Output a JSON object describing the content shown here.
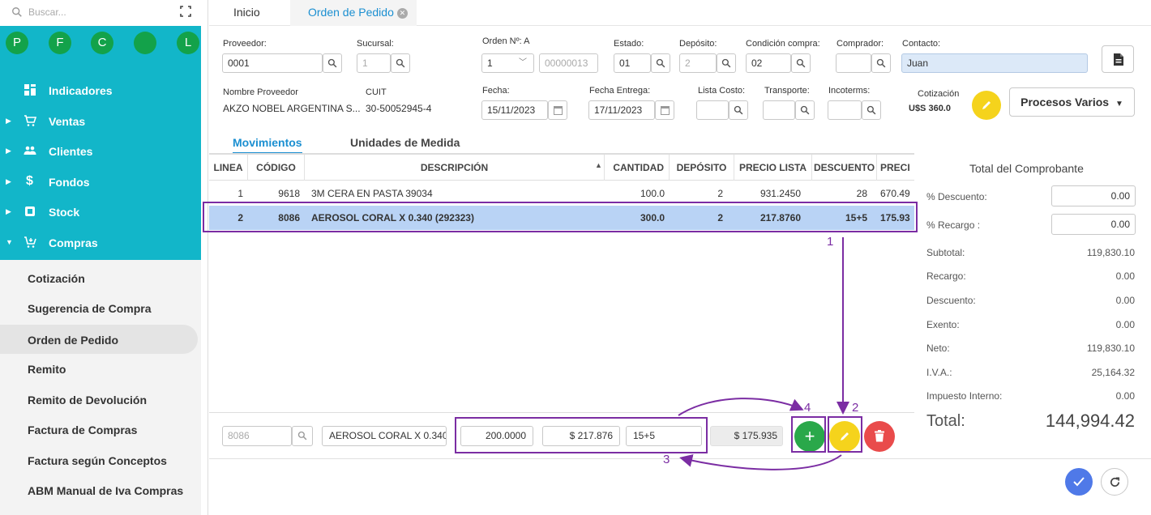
{
  "sidebar": {
    "search_placeholder": "Buscar...",
    "quick_circles": [
      "P",
      "F",
      "C",
      "",
      "L"
    ],
    "menu": [
      {
        "label": "Indicadores",
        "icon": "dashboard-icon",
        "expandable": false
      },
      {
        "label": "Ventas",
        "icon": "cart-icon",
        "expandable": true
      },
      {
        "label": "Clientes",
        "icon": "people-icon",
        "expandable": true
      },
      {
        "label": "Fondos",
        "icon": "dollar-icon",
        "expandable": true
      },
      {
        "label": "Stock",
        "icon": "box-icon",
        "expandable": true
      },
      {
        "label": "Compras",
        "icon": "cart-down-icon",
        "expandable": true,
        "expanded": true
      }
    ],
    "submenu": [
      {
        "label": "Cotización"
      },
      {
        "label": "Sugerencia de Compra"
      },
      {
        "label": "Orden de Pedido",
        "active": true
      },
      {
        "label": "Remito"
      },
      {
        "label": "Remito de Devolución"
      },
      {
        "label": "Factura de Compras"
      },
      {
        "label": "Factura según Conceptos"
      },
      {
        "label": "ABM Manual de Iva Compras"
      }
    ],
    "colors": {
      "teal": "#12b6c9",
      "green_circle": "#13a24a"
    }
  },
  "tabs": {
    "home": "Inicio",
    "current": "Orden de Pedido"
  },
  "header": {
    "proveedor_label": "Proveedor:",
    "proveedor_value": "0001",
    "sucursal_label": "Sucursal:",
    "sucursal_value": "1",
    "orden_label": "Orden Nº: A",
    "orden_select": "1",
    "orden_number": "00000013",
    "estado_label": "Estado:",
    "estado_value": "01",
    "deposito_label": "Depósito:",
    "deposito_value": "2",
    "condicion_label": "Condición compra:",
    "condicion_value": "02",
    "comprador_label": "Comprador:",
    "comprador_value": "",
    "contacto_label": "Contacto:",
    "contacto_value": "Juan",
    "nombre_label": "Nombre Proveedor",
    "nombre_value": "AKZO NOBEL ARGENTINA S...",
    "cuit_label": "CUIT",
    "cuit_value": "30-50052945-4",
    "fecha_label": "Fecha:",
    "fecha_value": "15/11/2023",
    "fecha_entrega_label": "Fecha Entrega:",
    "fecha_entrega_value": "17/11/2023",
    "lista_costo_label": "Lista Costo:",
    "transporte_label": "Transporte:",
    "incoterms_label": "Incoterms:",
    "cotizacion_label": "Cotización",
    "cotizacion_value": "U$S 360.0",
    "procesos_label": "Procesos Varios"
  },
  "section_tabs": {
    "movimientos": "Movimientos",
    "unidades": "Unidades de Medida"
  },
  "table": {
    "columns": [
      "LINEA",
      "CÓDIGO",
      "DESCRIPCIÓN",
      "CANTIDAD",
      "DEPÓSITO",
      "PRECIO LISTA",
      "DESCUENTO",
      "PRECI"
    ],
    "rows": [
      {
        "linea": "1",
        "codigo": "9618",
        "descripcion": "3M CERA EN PASTA 39034",
        "cantidad": "100.0",
        "deposito": "2",
        "precio_lista": "931.2450",
        "descuento": "28",
        "precio": "670.49"
      },
      {
        "linea": "2",
        "codigo": "8086",
        "descripcion": "AEROSOL CORAL X 0.340 (292323)",
        "cantidad": "300.0",
        "deposito": "2",
        "precio_lista": "217.8760",
        "descuento": "15+5",
        "precio": "175.93",
        "selected": true
      }
    ],
    "selected_color": "#b9d3f5"
  },
  "edit_row": {
    "codigo": "8086",
    "descripcion": "AEROSOL CORAL X 0.340",
    "cantidad": "200.0000",
    "precio": "$ 217.876",
    "descuento": "15+5",
    "total": "$ 175.935"
  },
  "totals": {
    "title": "Total del Comprobante",
    "descuento_pct_label": "% Descuento:",
    "descuento_pct_value": "0.00",
    "recargo_pct_label": "% Recargo :",
    "recargo_pct_value": "0.00",
    "lines": [
      {
        "label": "Subtotal:",
        "value": "119,830.10"
      },
      {
        "label": "Recargo:",
        "value": "0.00"
      },
      {
        "label": "Descuento:",
        "value": "0.00"
      },
      {
        "label": "Exento:",
        "value": "0.00"
      },
      {
        "label": "Neto:",
        "value": "119,830.10"
      },
      {
        "label": "I.V.A.:",
        "value": "25,164.32"
      },
      {
        "label": "Impuesto Interno:",
        "value": "0.00"
      }
    ],
    "total_label": "Total:",
    "total_value": "144,994.42"
  },
  "annotations": {
    "n1": "1",
    "n2": "2",
    "n3": "3",
    "n4": "4",
    "color": "#7b2da3"
  },
  "button_colors": {
    "add": "#2aa84a",
    "edit": "#f5d31c",
    "delete": "#e94b4b",
    "confirm": "#4f79e8"
  }
}
